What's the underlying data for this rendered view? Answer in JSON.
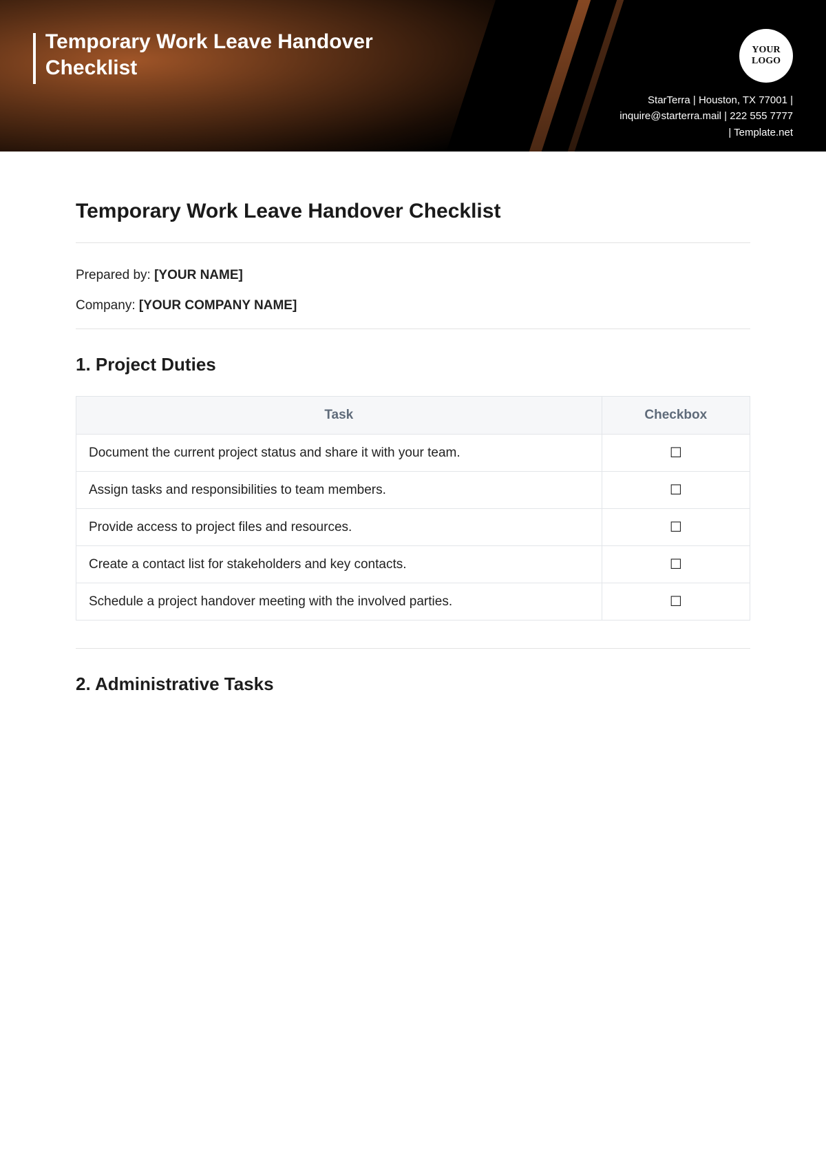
{
  "banner": {
    "title": "Temporary Work Leave Handover Checklist",
    "logo_line1": "YOUR",
    "logo_line2": "LOGO",
    "meta_line1": "StarTerra | Houston, TX 77001 |",
    "meta_line2": "inquire@starterra.mail | 222 555 7777",
    "meta_line3": "| Template.net"
  },
  "doc": {
    "title": "Temporary Work Leave Handover Checklist",
    "prepared_by_label": "Prepared by: ",
    "prepared_by_value": "[YOUR NAME]",
    "company_label": "Company: ",
    "company_value": "[YOUR COMPANY NAME]"
  },
  "sections": {
    "s1_title": "1. Project Duties",
    "s2_title": "2. Administrative Tasks"
  },
  "table_headers": {
    "task": "Task",
    "checkbox": "Checkbox"
  },
  "checkbox_glyph": "☐",
  "project_duties": [
    "Document the current project status and share it with your team.",
    "Assign tasks and responsibilities to team members.",
    "Provide access to project files and resources.",
    "Create a contact list for stakeholders and key contacts.",
    "Schedule a project handover meeting with the involved parties."
  ]
}
